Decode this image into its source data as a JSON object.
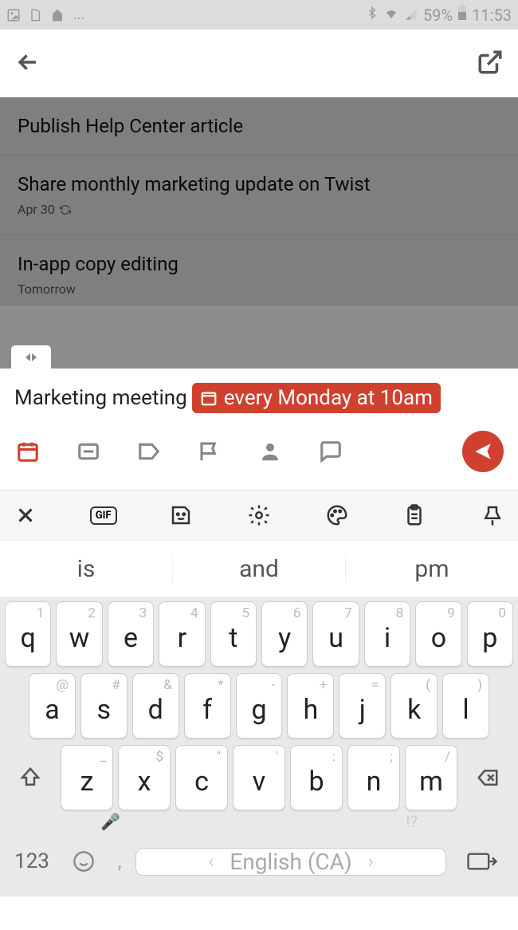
{
  "statusbar": {
    "battery": "59%",
    "time": "11:53"
  },
  "tasks": [
    {
      "title": "Publish Help Center article",
      "sub": ""
    },
    {
      "title": "Share monthly marketing update on Twist",
      "sub": "Apr 30"
    },
    {
      "title": "In-app copy editing",
      "sub": "Tomorrow"
    }
  ],
  "composer": {
    "text": "Marketing meeting",
    "chip": "every Monday at 10am"
  },
  "kbtoolbar": {
    "gif": "GIF"
  },
  "suggestions": [
    "is",
    "and",
    "pm"
  ],
  "keyboard": {
    "row1": [
      {
        "h": "1",
        "m": "q"
      },
      {
        "h": "2",
        "m": "w"
      },
      {
        "h": "3",
        "m": "e"
      },
      {
        "h": "4",
        "m": "r"
      },
      {
        "h": "5",
        "m": "t"
      },
      {
        "h": "6",
        "m": "y"
      },
      {
        "h": "7",
        "m": "u"
      },
      {
        "h": "8",
        "m": "i"
      },
      {
        "h": "9",
        "m": "o"
      },
      {
        "h": "0",
        "m": "p"
      }
    ],
    "row2": [
      {
        "h": "@",
        "m": "a"
      },
      {
        "h": "#",
        "m": "s"
      },
      {
        "h": "&",
        "m": "d"
      },
      {
        "h": "*",
        "m": "f"
      },
      {
        "h": "-",
        "m": "g"
      },
      {
        "h": "+",
        "m": "h"
      },
      {
        "h": "=",
        "m": "j"
      },
      {
        "h": "(",
        "m": "k"
      },
      {
        "h": ")",
        "m": "l"
      }
    ],
    "row3": [
      {
        "h": "_",
        "m": "z"
      },
      {
        "h": "$",
        "m": "x"
      },
      {
        "h": "\"",
        "m": "c"
      },
      {
        "h": "'",
        "m": "v"
      },
      {
        "h": ":",
        "m": "b"
      },
      {
        "h": ";",
        "m": "n"
      },
      {
        "h": "/",
        "m": "m"
      }
    ],
    "numLabel": "123",
    "spaceLabel": "English (CA)",
    "punctHint": "!?",
    "commaHint": ","
  }
}
